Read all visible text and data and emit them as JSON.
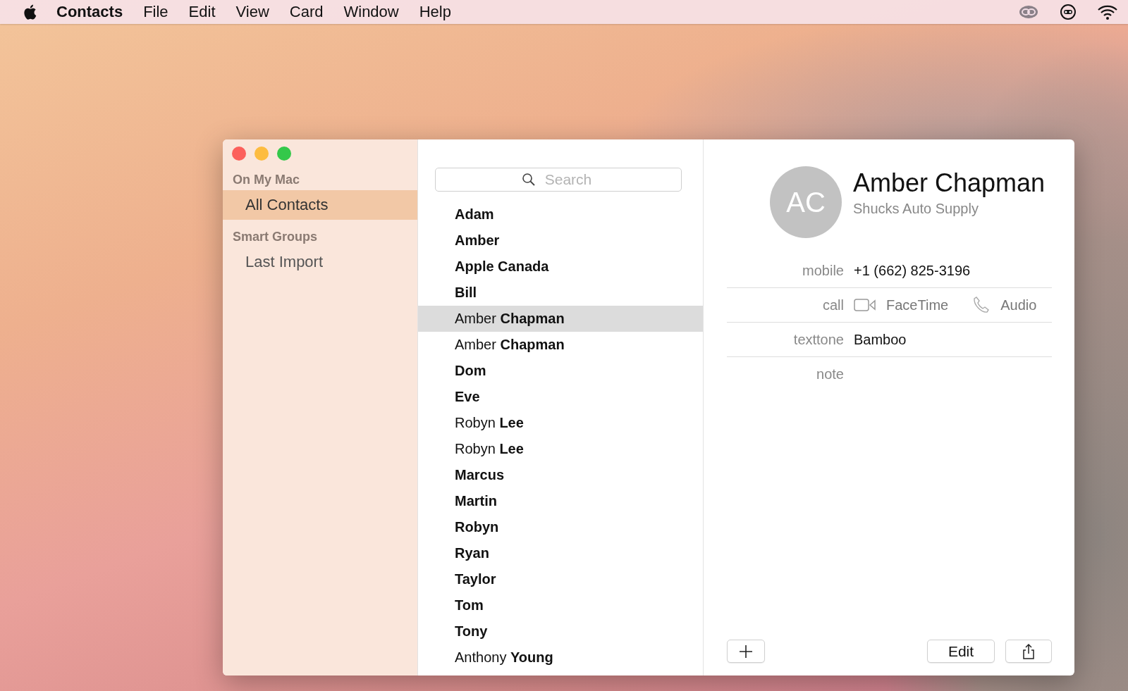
{
  "menu_bar": {
    "app_name": "Contacts",
    "menus": [
      "File",
      "Edit",
      "View",
      "Card",
      "Window",
      "Help"
    ]
  },
  "sidebar": {
    "sections": [
      {
        "title": "On My Mac",
        "items": [
          {
            "label": "All Contacts",
            "selected": true
          }
        ]
      },
      {
        "title": "Smart Groups",
        "items": [
          {
            "label": "Last Import",
            "selected": false
          }
        ]
      }
    ]
  },
  "search": {
    "placeholder": "Search"
  },
  "contacts": [
    {
      "first": "Adam",
      "selected": false
    },
    {
      "first": "Amber",
      "selected": false
    },
    {
      "first": "Apple Canada",
      "selected": false
    },
    {
      "first": "Bill",
      "selected": false
    },
    {
      "first": "Amber",
      "last": "Chapman",
      "selected": true
    },
    {
      "first": "Amber",
      "last": "Chapman",
      "selected": false
    },
    {
      "first": "Dom",
      "selected": false
    },
    {
      "first": "Eve",
      "selected": false
    },
    {
      "first": "Robyn",
      "last": "Lee",
      "selected": false
    },
    {
      "first": "Robyn",
      "last": "Lee",
      "selected": false
    },
    {
      "first": "Marcus",
      "selected": false
    },
    {
      "first": "Martin",
      "selected": false
    },
    {
      "first": "Robyn",
      "selected": false
    },
    {
      "first": "Ryan",
      "selected": false
    },
    {
      "first": "Taylor",
      "selected": false
    },
    {
      "first": "Tom",
      "selected": false
    },
    {
      "first": "Tony",
      "selected": false
    },
    {
      "first": "Anthony",
      "last": "Young",
      "selected": false
    }
  ],
  "card": {
    "initials": "AC",
    "name": "Amber Chapman",
    "company": "Shucks Auto Supply",
    "fields": [
      {
        "kind": "text",
        "label": "mobile",
        "value": "+1 (662) 825-3196"
      },
      {
        "kind": "call",
        "label": "call",
        "video": "FaceTime",
        "audio": "Audio"
      },
      {
        "kind": "text",
        "label": "texttone",
        "value": "Bamboo"
      },
      {
        "kind": "text",
        "label": "note"
      }
    ],
    "buttons": {
      "edit": "Edit"
    }
  }
}
